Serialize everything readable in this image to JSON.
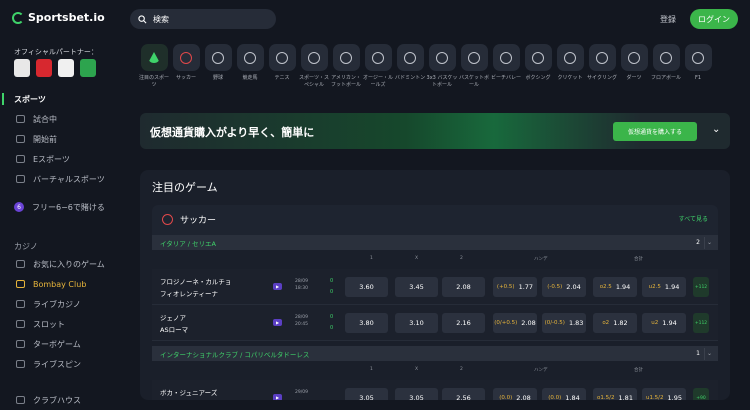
{
  "topbar": {
    "logo": "Sportsbet.io",
    "search_placeholder": "検索",
    "register": "登録",
    "login": "ログイン"
  },
  "sidebar": {
    "partner_title": "オフィシャルパートナー：",
    "partners": [
      {
        "name": "newcastle",
        "color": "#e8e8e8"
      },
      {
        "name": "southampton",
        "color": "#d7282f"
      },
      {
        "name": "sao-paulo",
        "color": "#f0f0f0"
      },
      {
        "name": "partner-4",
        "color": "#2da44e"
      }
    ],
    "items": [
      {
        "label": "スポーツ",
        "type": "head"
      },
      {
        "label": "試合中",
        "type": "sub"
      },
      {
        "label": "開始前",
        "type": "sub"
      },
      {
        "label": "Eスポーツ",
        "type": "sub"
      },
      {
        "label": "バーチャルスポーツ",
        "type": "sub"
      },
      {
        "label": "フリー6−6で賭ける",
        "type": "special"
      },
      {
        "label": "お気に入りのゲーム",
        "type": "sub"
      },
      {
        "label": "Bombay Club",
        "type": "gold"
      },
      {
        "label": "ライブカジノ",
        "type": "sub"
      },
      {
        "label": "スロット",
        "type": "sub"
      },
      {
        "label": "ターボゲーム",
        "type": "sub"
      },
      {
        "label": "ライブスピン",
        "type": "sub"
      },
      {
        "label": "クラブハウス",
        "type": "sub"
      }
    ],
    "casino_label": "カジノ",
    "six_badge": "6"
  },
  "categories": [
    {
      "label": "注目のスポーツ",
      "selected": true
    },
    {
      "label": "サッカー",
      "red": true
    },
    {
      "label": "野球"
    },
    {
      "label": "競走馬"
    },
    {
      "label": "テニス"
    },
    {
      "label": "スポーツ・スペシャル"
    },
    {
      "label": "アメリカン・フットボール"
    },
    {
      "label": "オージー・ルールズ"
    },
    {
      "label": "バドミントン"
    },
    {
      "label": "3x3 バスケットボール"
    },
    {
      "label": "バスケットボール"
    },
    {
      "label": "ビーチバレー"
    },
    {
      "label": "ボクシング"
    },
    {
      "label": "クリケット"
    },
    {
      "label": "サイクリング"
    },
    {
      "label": "ダーツ"
    },
    {
      "label": "フロアボール"
    },
    {
      "label": "F1"
    }
  ],
  "banner": {
    "text": "仮想通貨購入がより早く、簡単に",
    "button": "仮想通貨を購入する"
  },
  "featured": {
    "title": "注目のゲーム",
    "sport": "サッカー",
    "see_all": "すべて見る",
    "leagues": [
      {
        "label": "イタリア / セリエA",
        "count": "2"
      },
      {
        "label": "インターナショナルクラブ / コパリベルタドーレス",
        "count": "1"
      }
    ],
    "columns": {
      "c1": "1",
      "cx": "X",
      "c2": "2",
      "handicap": "ハンデ",
      "total": "合計"
    },
    "matches": [
      {
        "home": "フロジノーネ・カルチョ",
        "away": "フィオレンティーナ",
        "date": "28/09",
        "time": "18:30",
        "s1": "0",
        "s2": "0",
        "o1": "3.60",
        "ox": "3.45",
        "o2": "2.08",
        "h1l": "(+0.5)",
        "h1": "1.77",
        "h2l": "(-0.5)",
        "h2": "2.04",
        "t1l": "o2.5",
        "t1": "1.94",
        "t2l": "u2.5",
        "t2": "1.94",
        "more": "+112"
      },
      {
        "home": "ジェノア",
        "away": "ASローマ",
        "date": "28/09",
        "time": "20:45",
        "s1": "0",
        "s2": "0",
        "o1": "3.80",
        "ox": "3.10",
        "o2": "2.16",
        "h1l": "(0/+0.5)",
        "h1": "2.08",
        "h2l": "(0/-0.5)",
        "h2": "1.83",
        "t1l": "o2",
        "t1": "1.82",
        "t2l": "u2",
        "t2": "1.94",
        "more": "+112"
      },
      {
        "home": "ボカ・ジュニアーズ",
        "away": "",
        "date": "29/09",
        "time": "",
        "s1": "",
        "s2": "",
        "o1": "3.05",
        "ox": "3.05",
        "o2": "2.56",
        "h1l": "(0.0)",
        "h1": "2.08",
        "h2l": "(0.0)",
        "h2": "1.84",
        "t1l": "o1.5/2",
        "t1": "1.81",
        "t2l": "u1.5/2",
        "t2": "1.95",
        "more": "+90"
      }
    ]
  }
}
